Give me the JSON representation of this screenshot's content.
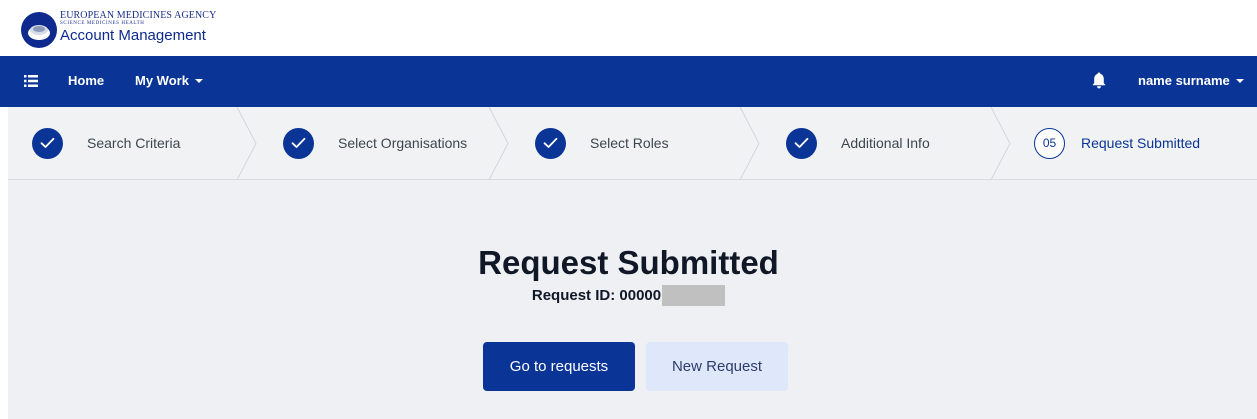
{
  "brand": {
    "agency_name": "EUROPEAN MEDICINES AGENCY",
    "tagline": "SCIENCE MEDICINES HEALTH",
    "app_name": "Account Management"
  },
  "navbar": {
    "home_label": "Home",
    "my_work_label": "My Work",
    "user_name": "name surname"
  },
  "stepper": {
    "steps": [
      {
        "label": "Search Criteria",
        "state": "completed"
      },
      {
        "label": "Select Organisations",
        "state": "completed"
      },
      {
        "label": "Select Roles",
        "state": "completed"
      },
      {
        "label": "Additional Info",
        "state": "completed"
      },
      {
        "label": "Request Submitted",
        "state": "current",
        "number": "05"
      }
    ]
  },
  "main": {
    "title": "Request Submitted",
    "request_id_label": "Request ID: 00000",
    "primary_button_label": "Go to requests",
    "secondary_button_label": "New Request"
  },
  "colors": {
    "primary": "#0a3596",
    "secondary_button_bg": "#dfe8fb",
    "stepper_bg": "#f1f2f4",
    "content_bg": "#eef0f3"
  }
}
